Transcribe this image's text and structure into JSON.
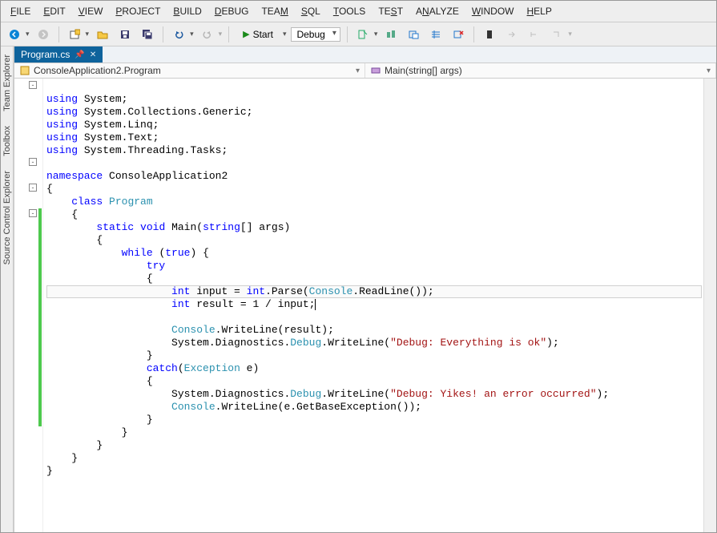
{
  "menu": {
    "file": "FILE",
    "edit": "EDIT",
    "view": "VIEW",
    "project": "PROJECT",
    "build": "BUILD",
    "debug": "DEBUG",
    "team": "TEAM",
    "sql": "SQL",
    "tools": "TOOLS",
    "test": "TEST",
    "analyze": "ANALYZE",
    "window": "WINDOW",
    "help": "HELP"
  },
  "toolbar": {
    "start_label": "Start",
    "config_selected": "Debug"
  },
  "side_tabs": {
    "team_explorer": "Team Explorer",
    "toolbox": "Toolbox",
    "source_control": "Source Control Explorer"
  },
  "doc_tab": {
    "title": "Program.cs"
  },
  "nav": {
    "left": "ConsoleApplication2.Program",
    "right": "Main(string[] args)"
  },
  "code": {
    "l1": "using System;",
    "l2": "using System.Collections.Generic;",
    "l3": "using System.Linq;",
    "l4": "using System.Text;",
    "l5": "using System.Threading.Tasks;",
    "l6": "",
    "l7": "namespace ConsoleApplication2",
    "l8": "{",
    "l9": "    class Program",
    "l10": "    {",
    "l11": "        static void Main(string[] args)",
    "l12": "        {",
    "l13": "            while (true) {",
    "l14": "                try",
    "l15": "                {",
    "l16": "                    int input = int.Parse(Console.ReadLine());",
    "l17": "                    int result = 1 / input;",
    "l18": "",
    "l19": "                    Console.WriteLine(result);",
    "l20": "                    System.Diagnostics.Debug.WriteLine(\"Debug: Everything is ok\");",
    "l21": "                }",
    "l22": "                catch(Exception e)",
    "l23": "                {",
    "l24": "                    System.Diagnostics.Debug.WriteLine(\"Debug: Yikes! an error occurred\");",
    "l25": "                    Console.WriteLine(e.GetBaseException());",
    "l26": "                }",
    "l27": "            }",
    "l28": "        }",
    "l29": "    }",
    "l30": "}"
  }
}
